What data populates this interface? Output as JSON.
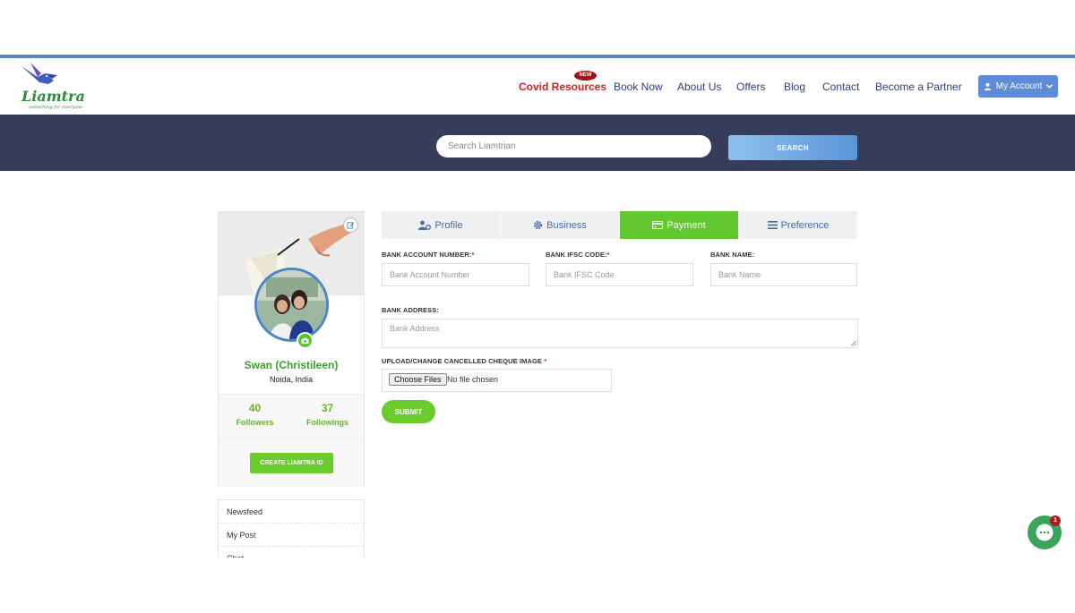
{
  "brand": {
    "name": "Liamtra",
    "tagline": "something for everyone"
  },
  "nav": {
    "new_badge": "NEW",
    "items": [
      {
        "label": "Covid Resources"
      },
      {
        "label": "Book Now"
      },
      {
        "label": "About Us"
      },
      {
        "label": "Offers"
      },
      {
        "label": "Blog"
      },
      {
        "label": "Contact"
      },
      {
        "label": "Become a Partner"
      }
    ],
    "account_label": "My Account"
  },
  "search": {
    "placeholder": "Search Liamtrian",
    "button_label": "SEARCH"
  },
  "profile": {
    "name": "Swan (Christileen)",
    "location": "Noida, India",
    "followers_count": "40",
    "followers_label": "Followers",
    "followings_count": "37",
    "followings_label": "Followings",
    "create_button": "CREATE LIAMTRA ID"
  },
  "side_menu": {
    "items": [
      "Newsfeed",
      "My Post",
      "Chat"
    ]
  },
  "tabs": [
    {
      "label": "Profile",
      "icon": "user-cog-icon",
      "active": false
    },
    {
      "label": "Business",
      "icon": "gear-icon",
      "active": false
    },
    {
      "label": "Payment",
      "icon": "credit-card-icon",
      "active": true
    },
    {
      "label": "Preference",
      "icon": "list-icon",
      "active": false
    }
  ],
  "form": {
    "bank_account_label": "BANK ACCOUNT NUMBER:",
    "bank_account_required": "*",
    "bank_account_placeholder": "Bank Account Number",
    "ifsc_label": "BANK IFSC CODE:",
    "ifsc_required": "*",
    "ifsc_placeholder": "Bank IFSC Code",
    "bank_name_label": "BANK NAME:",
    "bank_name_placeholder": "Bank Name",
    "bank_address_label": "BANK ADDRESS:",
    "bank_address_placeholder": "Bank Address",
    "cheque_label": "UPLOAD/CHANGE CANCELLED CHEQUE IMAGE",
    "cheque_required": "*",
    "choose_files_label": "Choose Files",
    "file_status": "No file chosen",
    "submit_label": "SUBMIT"
  },
  "chat": {
    "unread_count": "1"
  },
  "colors": {
    "accent_green": "#6acb2c",
    "nav_blue": "#2b3f82",
    "covid_red": "#d11f1f",
    "search_band": "#363d5a",
    "account_button": "#5f8cd6"
  }
}
